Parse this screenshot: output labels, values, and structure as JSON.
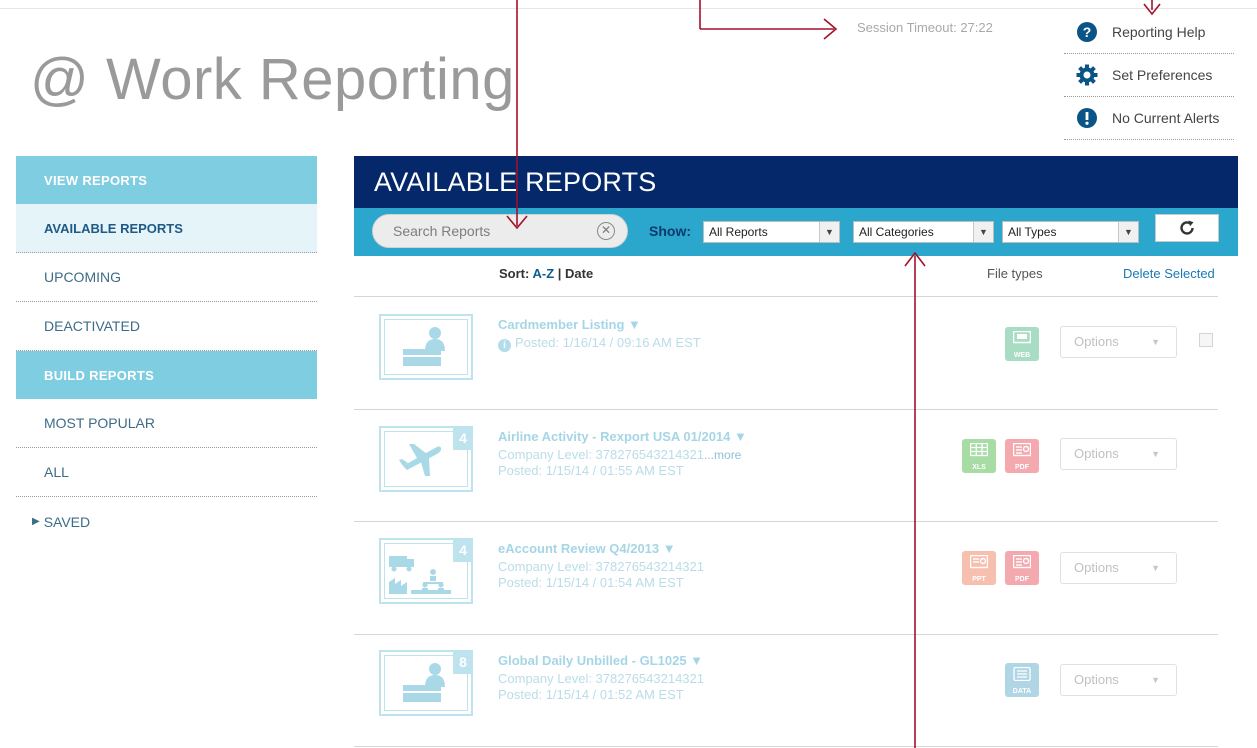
{
  "app": {
    "title": "@ Work Reporting",
    "session_timeout": "Session Timeout: 27:22"
  },
  "help_menu": [
    {
      "label": "Reporting Help",
      "icon": "question-icon"
    },
    {
      "label": "Set Preferences",
      "icon": "gear-icon"
    },
    {
      "label": "No Current Alerts",
      "icon": "alert-icon"
    }
  ],
  "sidebar": {
    "view_header": "VIEW REPORTS",
    "view_items": [
      "AVAILABLE REPORTS",
      "UPCOMING",
      "DEACTIVATED"
    ],
    "build_header": "BUILD REPORTS",
    "build_items": [
      "MOST POPULAR",
      "ALL"
    ],
    "saved_label": "SAVED"
  },
  "main": {
    "header": "AVAILABLE REPORTS",
    "search_placeholder": "Search Reports",
    "show_label": "Show:",
    "filters": {
      "reports": "All Reports",
      "categories": "All Categories",
      "types": "All Types"
    },
    "sort_label": "Sort:",
    "sort_az": "A-Z",
    "sort_sep": "|",
    "sort_date": "Date",
    "file_types_label": "File types",
    "delete_selected": "Delete Selected"
  },
  "reports": [
    {
      "title": "Cardmember Listing ▼",
      "lines": [
        "Posted: 1/16/14 / 09:16 AM EST"
      ],
      "badge": "",
      "file_types": [
        "WEB"
      ],
      "options": "Options"
    },
    {
      "title": "Airline Activity - Rexport USA 01/2014 ▼",
      "lines": [
        "Company Level: 378276543214321",
        "Posted: 1/15/14 / 01:55 AM EST"
      ],
      "more": "...more",
      "badge": "4",
      "file_types": [
        "XLS",
        "PDF"
      ],
      "options": "Options"
    },
    {
      "title": "eAccount Review Q4/2013 ▼",
      "lines": [
        "Company Level: 378276543214321",
        "Posted: 1/15/14 / 01:54 AM EST"
      ],
      "badge": "4",
      "file_types": [
        "PPT",
        "PDF"
      ],
      "options": "Options"
    },
    {
      "title": "Global Daily Unbilled - GL1025 ▼",
      "lines": [
        "Company Level: 378276543214321",
        "Posted: 1/15/14 / 01:52 AM EST"
      ],
      "badge": "8",
      "file_types": [
        "DATA"
      ],
      "options": "Options"
    }
  ],
  "colors": {
    "header_navy": "#05286a",
    "toolbar_blue": "#2ba7cd",
    "sidebar_header": "#7fcde0",
    "annotation_red": "#a4102a"
  }
}
